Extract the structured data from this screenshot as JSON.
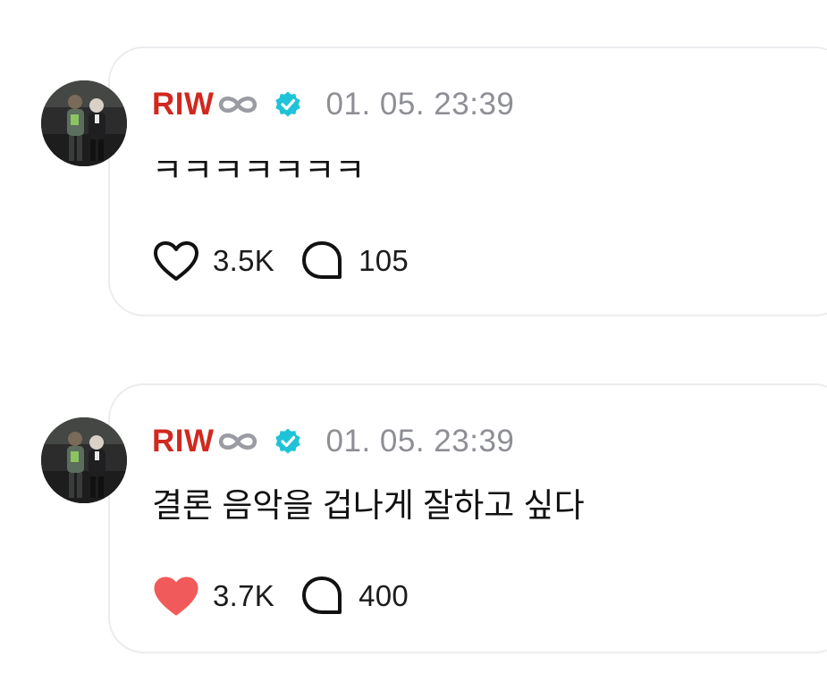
{
  "posts": [
    {
      "author": "RIW",
      "author_badge_icon": "infinity-icon",
      "verified_icon": "verified-badge-icon",
      "timestamp": "01. 05. 23:39",
      "text": "ㅋㅋㅋㅋㅋㅋㅋ",
      "likes": "3.5K",
      "liked": false,
      "comments": "105"
    },
    {
      "author": "RIW",
      "author_badge_icon": "infinity-icon",
      "verified_icon": "verified-badge-icon",
      "timestamp": "01. 05. 23:39",
      "text": "결론 음악을 겁나게 잘하고 싶다",
      "likes": "3.7K",
      "liked": true,
      "comments": "400"
    }
  ],
  "colors": {
    "author_name": "#d1281f",
    "verified_badge": "#1fc3d8",
    "timestamp": "#8d8f95",
    "heart_liked": "#f15a5a",
    "card_border": "#ececf0"
  }
}
